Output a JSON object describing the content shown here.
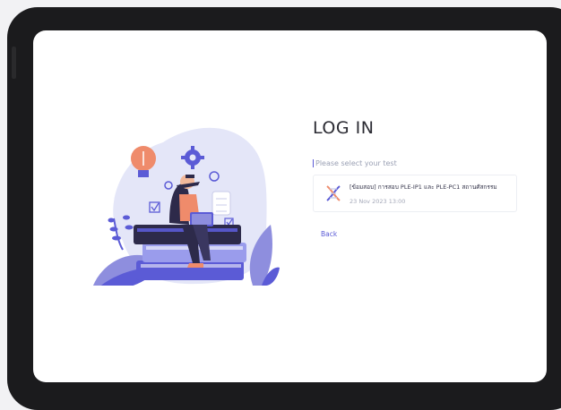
{
  "login": {
    "title": "LOG IN",
    "subtitle": "Please select your test",
    "tests": [
      {
        "name": "[ข้อมสอบ] การสอบ PLE-IP1 และ PLE-PC1 สถานศัสกรรม",
        "date": "23 Nov 2023 13:00",
        "icon": "dna-icon"
      }
    ],
    "back_label": "Back"
  },
  "colors": {
    "accent": "#5b5bd6",
    "illustration_bg": "#e4e6f8",
    "card_border": "#eceef3"
  }
}
